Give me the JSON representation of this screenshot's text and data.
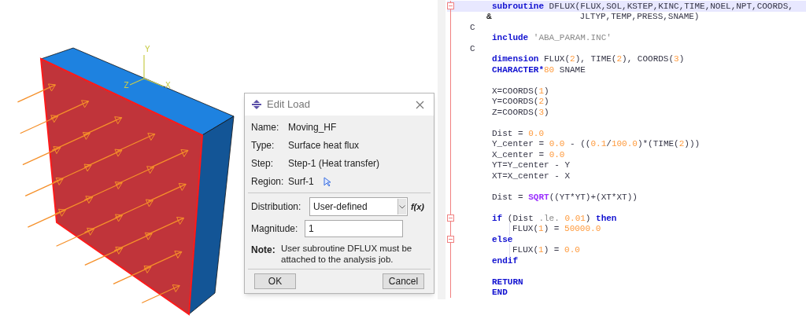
{
  "viewport": {
    "axes": [
      {
        "label": "Y"
      },
      {
        "label": "Z"
      },
      {
        "label": "X"
      }
    ]
  },
  "dialog": {
    "title": "Edit Load",
    "fields": [
      {
        "label": "Name:",
        "value": "Moving_HF"
      },
      {
        "label": "Type:",
        "value": "Surface heat flux"
      },
      {
        "label": "Step:",
        "value": "Step-1 (Heat transfer)"
      },
      {
        "label": "Region:",
        "value": "Surf-1",
        "pick_icon": true
      }
    ],
    "distribution": {
      "label": "Distribution:",
      "value": "User-defined",
      "function_button": "f(x)"
    },
    "magnitude": {
      "label": "Magnitude:",
      "value": "1"
    },
    "note": {
      "label": "Note:",
      "text": "User subroutine DFLUX must be attached to the analysis job."
    },
    "buttons": [
      "OK",
      "Cancel"
    ]
  },
  "editor": {
    "lines": [
      {
        "kind": "code",
        "highlighted": true,
        "fold": true,
        "tokens": [
          {
            "kind": "kw",
            "s": "subroutine"
          },
          {
            "kind": "plain",
            "s": " DFLUX(FLUX,SOL,KSTEP,KINC,TIME,NOEL,NPT,COORDS,"
          }
        ]
      },
      {
        "kind": "continuation",
        "mark": "&",
        "tokens": [
          {
            "kind": "plain",
            "s": "JLTYP,TEMP,PRESS,SNAME)"
          }
        ]
      },
      {
        "kind": "comment",
        "tokens": [
          {
            "kind": "plain",
            "s": "C"
          }
        ]
      },
      {
        "kind": "code",
        "tokens": [
          {
            "kind": "kw",
            "s": "include"
          },
          {
            "kind": "str",
            "s": " 'ABA_PARAM.INC'"
          }
        ]
      },
      {
        "kind": "comment",
        "tokens": [
          {
            "kind": "plain",
            "s": "C"
          }
        ]
      },
      {
        "kind": "code",
        "tokens": [
          {
            "kind": "kw",
            "s": "dimension"
          },
          {
            "kind": "plain",
            "s": " FLUX("
          },
          {
            "kind": "num",
            "s": "2"
          },
          {
            "kind": "plain",
            "s": "), TIME("
          },
          {
            "kind": "num",
            "s": "2"
          },
          {
            "kind": "plain",
            "s": "), COORDS("
          },
          {
            "kind": "num",
            "s": "3"
          },
          {
            "kind": "plain",
            "s": ")"
          }
        ]
      },
      {
        "kind": "code",
        "tokens": [
          {
            "kind": "kw",
            "s": "CHARACTER*"
          },
          {
            "kind": "num",
            "s": "80"
          },
          {
            "kind": "plain",
            "s": " SNAME"
          }
        ]
      },
      {
        "kind": "blank"
      },
      {
        "kind": "code",
        "tokens": [
          {
            "kind": "plain",
            "s": "X=COORDS("
          },
          {
            "kind": "num",
            "s": "1"
          },
          {
            "kind": "plain",
            "s": ")"
          }
        ]
      },
      {
        "kind": "code",
        "tokens": [
          {
            "kind": "plain",
            "s": "Y=COORDS("
          },
          {
            "kind": "num",
            "s": "2"
          },
          {
            "kind": "plain",
            "s": ")"
          }
        ]
      },
      {
        "kind": "code",
        "tokens": [
          {
            "kind": "plain",
            "s": "Z=COORDS("
          },
          {
            "kind": "num",
            "s": "3"
          },
          {
            "kind": "plain",
            "s": ")"
          }
        ]
      },
      {
        "kind": "blank"
      },
      {
        "kind": "code",
        "tokens": [
          {
            "kind": "plain",
            "s": "Dist = "
          },
          {
            "kind": "num",
            "s": "0.0"
          }
        ]
      },
      {
        "kind": "code",
        "tokens": [
          {
            "kind": "plain",
            "s": "Y_center = "
          },
          {
            "kind": "num",
            "s": "0.0"
          },
          {
            "kind": "plain",
            "s": " - (("
          },
          {
            "kind": "num",
            "s": "0.1"
          },
          {
            "kind": "plain",
            "s": "/"
          },
          {
            "kind": "num",
            "s": "100.0"
          },
          {
            "kind": "plain",
            "s": ")*(TIME("
          },
          {
            "kind": "num",
            "s": "2"
          },
          {
            "kind": "plain",
            "s": ")))"
          }
        ]
      },
      {
        "kind": "code",
        "tokens": [
          {
            "kind": "plain",
            "s": "X_center = "
          },
          {
            "kind": "num",
            "s": "0.0"
          }
        ]
      },
      {
        "kind": "code",
        "tokens": [
          {
            "kind": "plain",
            "s": "YT=Y_center - Y"
          }
        ]
      },
      {
        "kind": "code",
        "tokens": [
          {
            "kind": "plain",
            "s": "XT=X_center - X"
          }
        ]
      },
      {
        "kind": "blank"
      },
      {
        "kind": "code",
        "tokens": [
          {
            "kind": "plain",
            "s": "Dist = "
          },
          {
            "kind": "fn",
            "s": "SQRT"
          },
          {
            "kind": "plain",
            "s": "((YT*YT)+(XT*XT))"
          }
        ]
      },
      {
        "kind": "blank"
      },
      {
        "kind": "code",
        "fold": true,
        "tokens": [
          {
            "kind": "kw",
            "s": "if"
          },
          {
            "kind": "plain",
            "s": " (Dist "
          },
          {
            "kind": "str",
            "s": ".le. "
          },
          {
            "kind": "num",
            "s": "0.01"
          },
          {
            "kind": "plain",
            "s": ") "
          },
          {
            "kind": "kw",
            "s": "then"
          }
        ]
      },
      {
        "kind": "nested",
        "tokens": [
          {
            "kind": "plain",
            "s": "FLUX("
          },
          {
            "kind": "num",
            "s": "1"
          },
          {
            "kind": "plain",
            "s": ") = "
          },
          {
            "kind": "num",
            "s": "50000.0"
          }
        ]
      },
      {
        "kind": "code",
        "fold": true,
        "tokens": [
          {
            "kind": "kw",
            "s": "else"
          }
        ]
      },
      {
        "kind": "nested",
        "tokens": [
          {
            "kind": "plain",
            "s": "FLUX("
          },
          {
            "kind": "num",
            "s": "1"
          },
          {
            "kind": "plain",
            "s": ") = "
          },
          {
            "kind": "num",
            "s": "0.0"
          }
        ]
      },
      {
        "kind": "code",
        "tokens": [
          {
            "kind": "kw",
            "s": "endif"
          }
        ]
      },
      {
        "kind": "blank"
      },
      {
        "kind": "code",
        "tokens": [
          {
            "kind": "kw",
            "s": "RETURN"
          }
        ]
      },
      {
        "kind": "code",
        "tokens": [
          {
            "kind": "kw",
            "s": "END"
          }
        ]
      }
    ]
  }
}
